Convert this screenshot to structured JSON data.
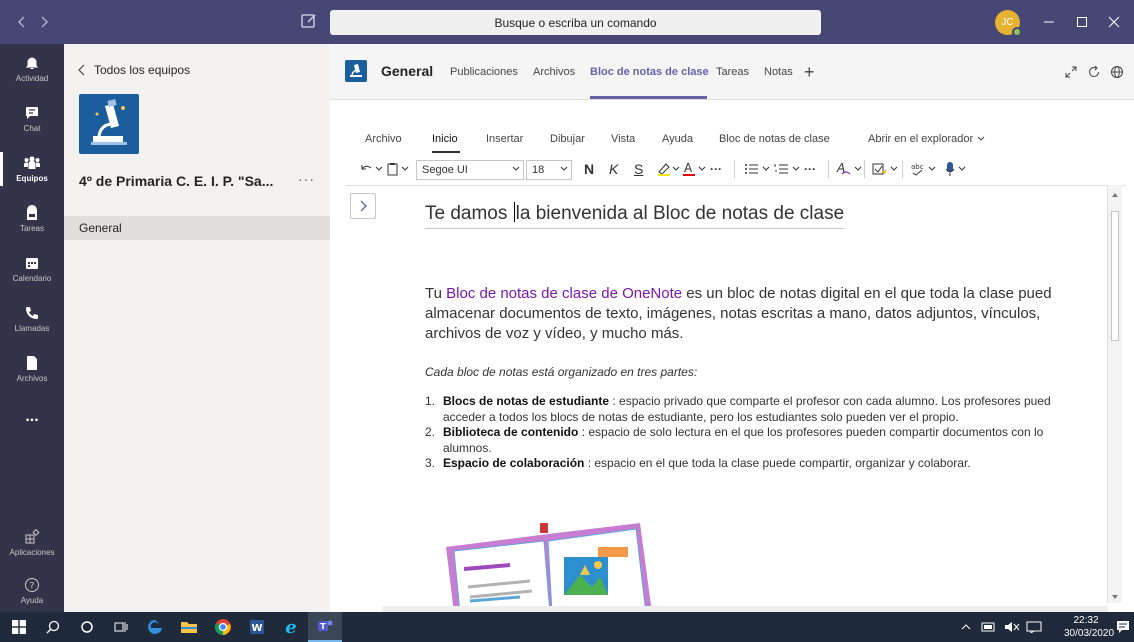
{
  "titlebar": {
    "search_placeholder": "Busque o escriba un comando",
    "avatar_initials": "JC",
    "colors": {
      "background": "#464775",
      "presence": "#92c353"
    }
  },
  "appbar": {
    "items": [
      {
        "label": "Actividad",
        "icon": "bell-icon"
      },
      {
        "label": "Chat",
        "icon": "chat-icon"
      },
      {
        "label": "Equipos",
        "icon": "teams-icon",
        "active": true
      },
      {
        "label": "Tareas",
        "icon": "backpack-icon"
      },
      {
        "label": "Calendario",
        "icon": "calendar-icon"
      },
      {
        "label": "Llamadas",
        "icon": "phone-icon"
      },
      {
        "label": "Archivos",
        "icon": "file-icon"
      },
      {
        "label": "...",
        "icon": "more-icon"
      }
    ],
    "bottom_items": [
      {
        "label": "Aplicaciones",
        "icon": "apps-icon"
      },
      {
        "label": "Ayuda",
        "icon": "help-icon"
      }
    ]
  },
  "team_panel": {
    "back_label": "Todos los equipos",
    "team_name": "4º de Primaria C. E. I. P. \"Sa...",
    "more": "···",
    "channels": [
      "General"
    ]
  },
  "channel": {
    "name": "General",
    "tabs": [
      "Publicaciones",
      "Archivos",
      "Bloc de notas de clase",
      "Tareas",
      "Notas"
    ],
    "active_tab": "Bloc de notas de clase",
    "add_tab": "+"
  },
  "ribbon": {
    "tabs": [
      "Archivo",
      "Inicio",
      "Insertar",
      "Dibujar",
      "Vista",
      "Ayuda",
      "Bloc de notas de clase",
      "Abrir en el explorador"
    ],
    "active_tab": "Inicio",
    "font_name": "Segoe UI",
    "font_size": "18",
    "bold": "N",
    "italic": "K",
    "underline": "S",
    "more": "···",
    "spell": "abc"
  },
  "page": {
    "title_before": "Te damos ",
    "title_after": "la bienvenida al Bloc de notas de clase",
    "intro_prefix": "Tu ",
    "intro_link": "Bloc de notas de clase de OneNote",
    "intro_line1_rest": " es un bloc de notas digital en el que toda la clase pued",
    "intro_line2": "almacenar documentos de texto, imágenes, notas escritas a mano, datos adjuntos, vínculos,",
    "intro_line3": "archivos de voz y vídeo, y mucho más.",
    "subtitle": "Cada bloc de notas está organizado en tres partes:",
    "parts": [
      {
        "num": "1.",
        "title": "Blocs de notas de estudiante",
        "line1": " : espacio privado que comparte el profesor con cada alumno. Los profesores pued",
        "line2": "acceder a todos los blocs de notas de estudiante, pero los estudiantes solo pueden ver el propio."
      },
      {
        "num": "2.",
        "title": "Biblioteca de contenido",
        "line1": " : espacio de solo lectura en el que los profesores pueden compartir documentos con lo",
        "line2": "alumnos."
      },
      {
        "num": "3.",
        "title": "Espacio de colaboración",
        "line1": " : espacio en el que toda la clase puede compartir, organizar y colaborar.",
        "line2": ""
      }
    ]
  },
  "taskbar": {
    "time": "22:32",
    "date": "30/03/2020"
  }
}
